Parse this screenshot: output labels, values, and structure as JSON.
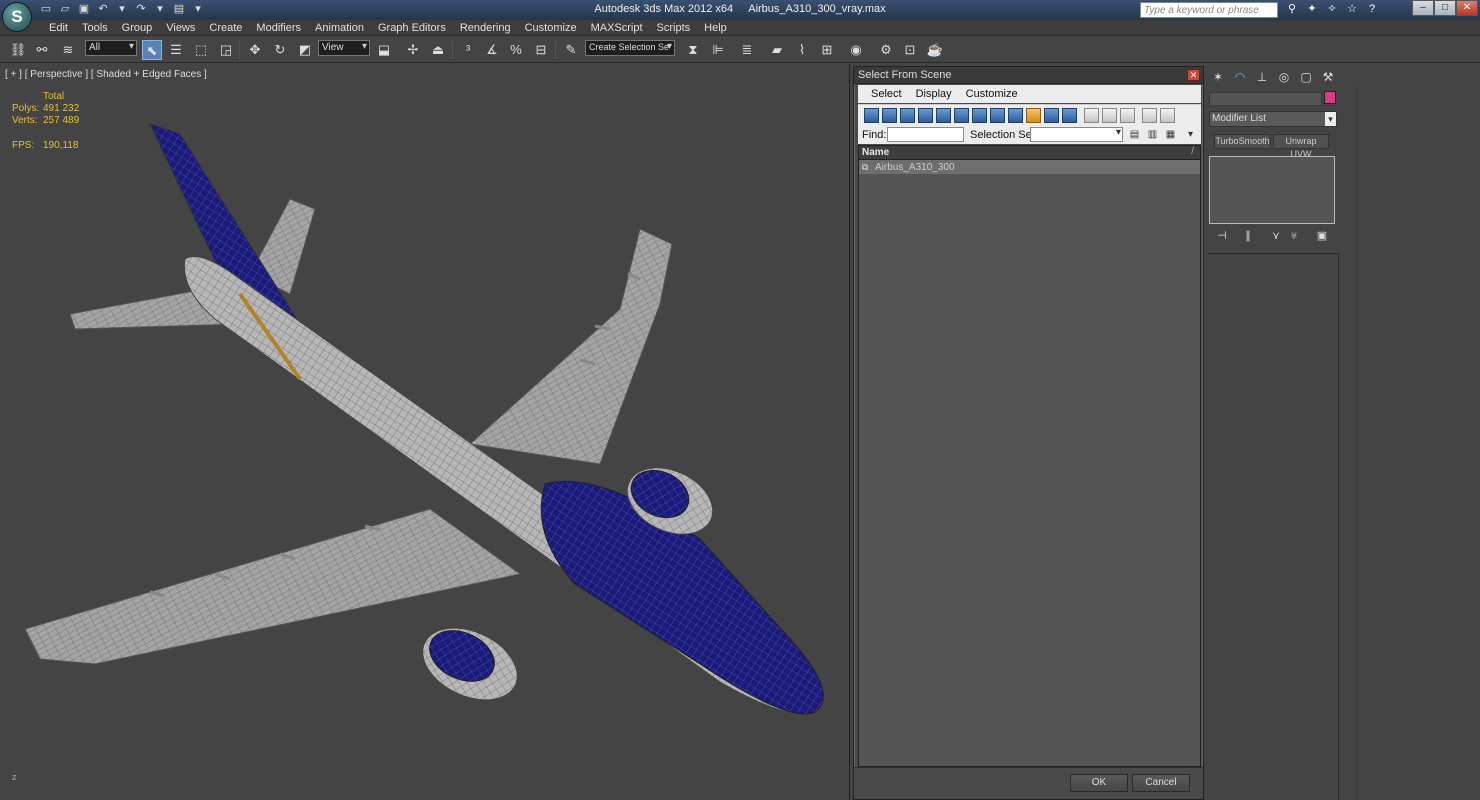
{
  "window": {
    "app_title": "Autodesk 3ds Max  2012 x64",
    "file_name": "Airbus_A310_300_vray.max",
    "search_placeholder": "Type a keyword or phrase"
  },
  "menu": [
    "Edit",
    "Tools",
    "Group",
    "Views",
    "Create",
    "Modifiers",
    "Animation",
    "Graph Editors",
    "Rendering",
    "Customize",
    "MAXScript",
    "Scripts",
    "Help"
  ],
  "toolbar": {
    "filter_value": "All",
    "coord_value": "View",
    "named_selection_placeholder": "Create Selection Se"
  },
  "viewport": {
    "label": "[ + ] [ Perspective ] [ Shaded + Edged Faces ]",
    "stats_header": "Total",
    "polys_label": "Polys:",
    "polys_value": "491 232",
    "verts_label": "Verts:",
    "verts_value": "257 489",
    "fps_label": "FPS:",
    "fps_value": "190,118",
    "axis_label": "z"
  },
  "dialog": {
    "title": "Select From Scene",
    "menu": [
      "Select",
      "Display",
      "Customize"
    ],
    "find_label": "Find:",
    "selection_set_label": "Selection Set:",
    "column_name": "Name",
    "column_sort": "/",
    "rows": [
      "Airbus_A310_300"
    ],
    "ok_label": "OK",
    "cancel_label": "Cancel"
  },
  "command_panel": {
    "modifier_list_label": "Modifier List",
    "modifier_buttons": [
      "TurboSmooth",
      "Unwrap UVW"
    ],
    "object_color": "#d83a8a"
  },
  "colors": {
    "fuselage_blue": "#1a1a7a",
    "stats_yellow": "#e3c232",
    "viewport_bg": "#444444"
  }
}
